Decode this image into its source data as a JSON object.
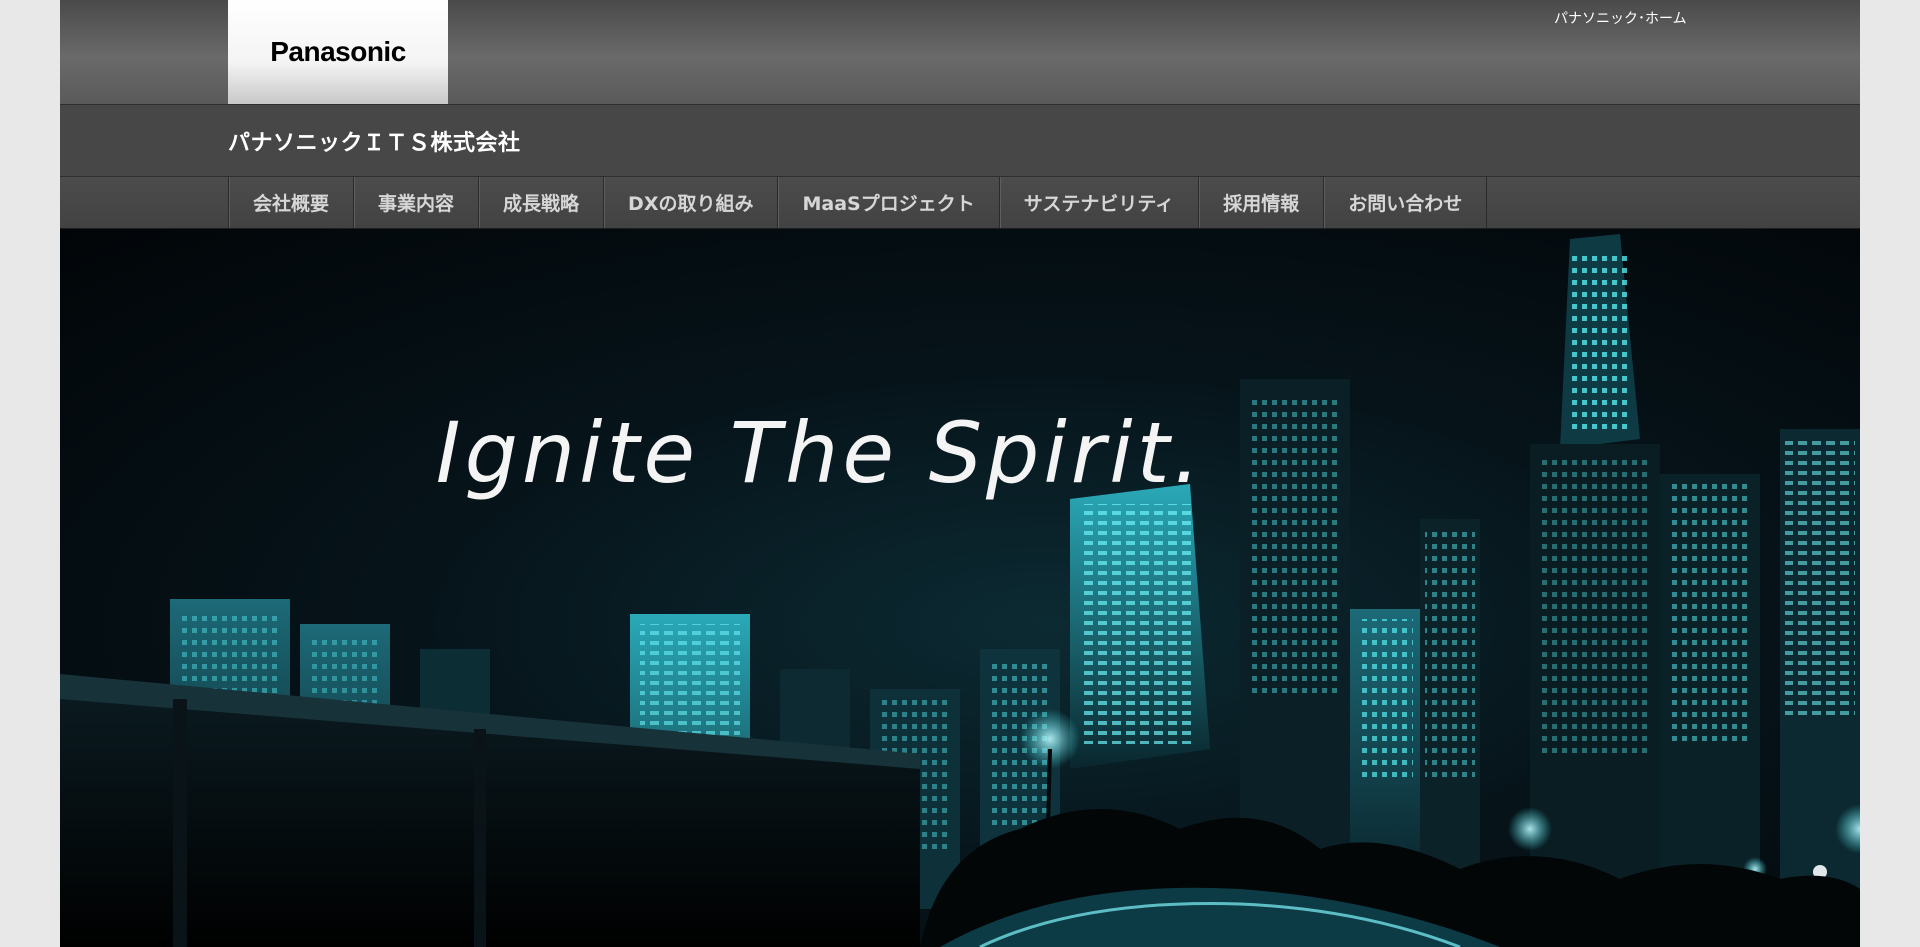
{
  "header": {
    "logo_text": "Panasonic",
    "home_link": "パナソニック･ホーム",
    "company_name": "パナソニックＩＴＳ株式会社"
  },
  "nav": {
    "items": [
      {
        "label": "会社概要"
      },
      {
        "label": "事業内容"
      },
      {
        "label": "成長戦略"
      },
      {
        "label": "DXの取り組み"
      },
      {
        "label": "MaaSプロジェクト"
      },
      {
        "label": "サステナビリティ"
      },
      {
        "label": "採用情報"
      },
      {
        "label": "お問い合わせ"
      }
    ]
  },
  "hero": {
    "tagline": "Ignite The Spirit."
  },
  "colors": {
    "accent_cyan": "#3de0e8",
    "header_gray": "#5a5a5a",
    "nav_gray": "#444444",
    "text_nav": "#d6d6d6"
  }
}
